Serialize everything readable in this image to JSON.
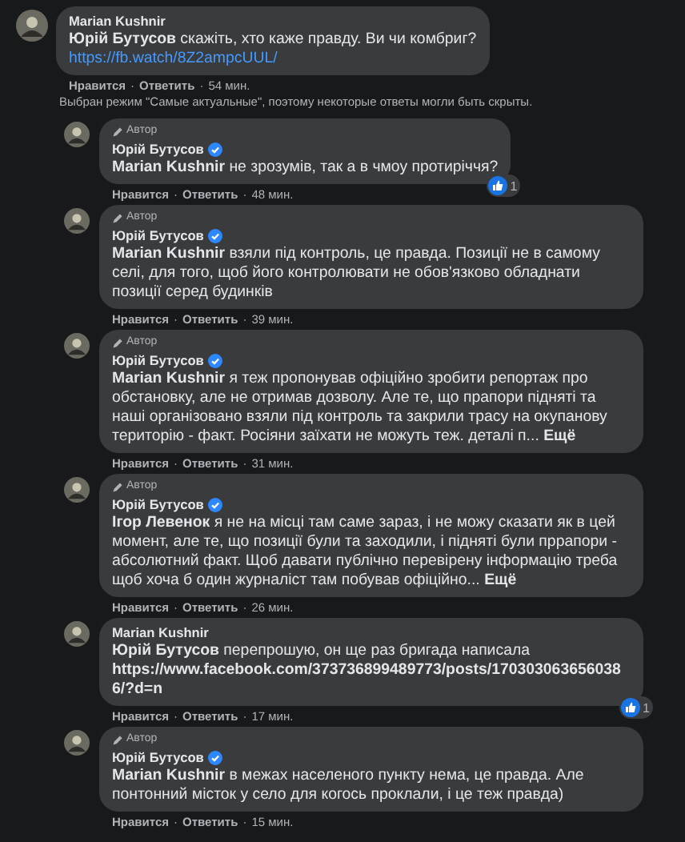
{
  "separator": "·",
  "thread": {
    "author": "Marian Kushnir",
    "verified": false,
    "text": "**Юрій Бутусов** скажіть, хто каже правду. Ви чи комбриг?",
    "link": {
      "text": "https://fb.watch/8Z2ampcUUL/",
      "kind": "external"
    },
    "actions": [
      "Нравится",
      "Ответить"
    ],
    "time": "54 мин.",
    "notice": "Выбран режим \"Самые актуальные\", поэтому некоторые ответы могли быть скрыты.",
    "children": [
      {
        "author": "Юрій Бутусов",
        "author_badge": "Автор",
        "verified": true,
        "text": "**Marian Kushnir** не зрозумів, так а в чмоу протиріччя?",
        "actions": [
          "Нравится",
          "Ответить"
        ],
        "time": "48 мин.",
        "reaction_count": "1"
      },
      {
        "author": "Юрій Бутусов",
        "author_badge": "Автор",
        "verified": true,
        "text": "**Marian Kushnir** взяли під контроль, це правда. Позиції не в самому селі, для того, щоб його контролювати не обов'язково обладнати позиції серед будинків",
        "actions": [
          "Нравится",
          "Ответить"
        ],
        "time": "39 мин."
      },
      {
        "author": "Юрій Бутусов",
        "author_badge": "Автор",
        "verified": true,
        "text": "**Marian Kushnir** я теж пропонував офіційно зробити репортаж про обстановку, але не отримав дозволу. Але те, що прапори підняті та наші організовано взяли під контроль та закрили трасу на окупанову територію - факт. Росіяни заїхати не можуть теж. деталі п...",
        "more": "Ещё",
        "actions": [
          "Нравится",
          "Ответить"
        ],
        "time": "31 мин."
      },
      {
        "author": "Юрій Бутусов",
        "author_badge": "Автор",
        "verified": true,
        "text": "**Ігор Левенок** я не на місці там саме зараз, і не можу сказати як в цей момент, але те, що позиції були та заходили, і підняті були пррапори - абсолютний факт. Щоб давати публічно перевірену інформацію треба щоб хоча б один журналіст там побував офіційно...",
        "more": "Ещё",
        "actions": [
          "Нравится",
          "Ответить"
        ],
        "time": "26 мин."
      },
      {
        "author": "Marian Kushnir",
        "verified": false,
        "text": "**Юрій Бутусов** перепрошую, он ще раз бригада написала",
        "link": {
          "text": "https://www.facebook.com/373736899489773/posts/1703030636560386/?d=n",
          "kind": "inline"
        },
        "actions": [
          "Нравится",
          "Ответить"
        ],
        "time": "17 мин.",
        "reaction_count": "1"
      },
      {
        "author": "Юрій Бутусов",
        "author_badge": "Автор",
        "verified": true,
        "text": "**Marian Kushnir** в межах населеного пункту нема, це правда. Але понтонний місток у село для когось проклали, і це теж правда)",
        "actions": [
          "Нравится",
          "Ответить"
        ],
        "time": "15 мин."
      }
    ]
  }
}
